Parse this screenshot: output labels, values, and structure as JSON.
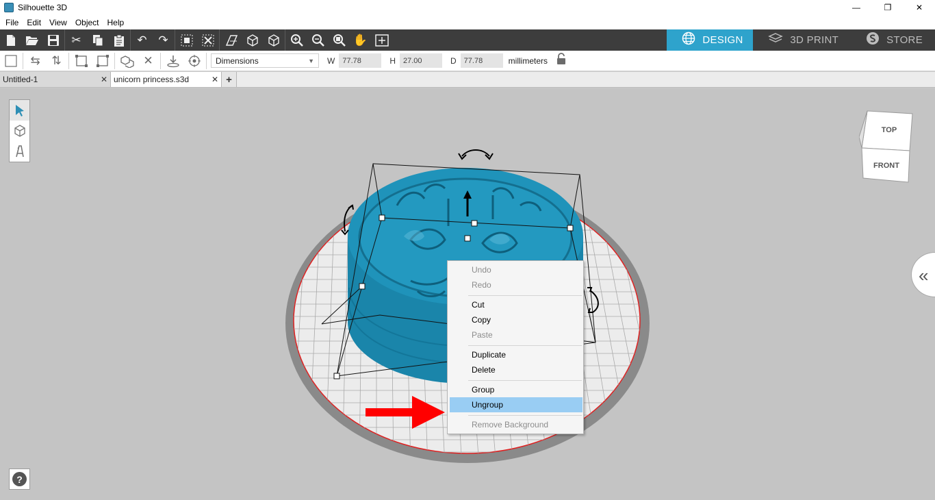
{
  "window": {
    "title": "Silhouette 3D",
    "minimize": "—",
    "maximize": "❐",
    "close": "✕"
  },
  "menu": [
    "File",
    "Edit",
    "View",
    "Object",
    "Help"
  ],
  "toolbar": {
    "modes": [
      {
        "label": "DESIGN",
        "icon": "globe-icon",
        "active": true
      },
      {
        "label": "3D PRINT",
        "icon": "print-layers-icon",
        "active": false
      },
      {
        "label": "STORE",
        "icon": "store-s-icon",
        "active": false
      }
    ]
  },
  "properties": {
    "mode_select": "Dimensions",
    "w_label": "W",
    "w_value": "77.78",
    "h_label": "H",
    "h_value": "27.00",
    "d_label": "D",
    "d_value": "77.78",
    "unit": "millimeters"
  },
  "tabs": [
    {
      "label": "Untitled-1",
      "close": "✕",
      "active": false
    },
    {
      "label": "unicorn princess.s3d",
      "close": "✕",
      "active": true
    }
  ],
  "add_tab": "+",
  "view_cube": {
    "top": "TOP",
    "front": "FRONT"
  },
  "help": "?",
  "context_menu": {
    "items": [
      {
        "label": "Undo",
        "enabled": false
      },
      {
        "label": "Redo",
        "enabled": false
      },
      {
        "label": "Cut",
        "enabled": true
      },
      {
        "label": "Copy",
        "enabled": true
      },
      {
        "label": "Paste",
        "enabled": false
      },
      {
        "label": "Duplicate",
        "enabled": true
      },
      {
        "label": "Delete",
        "enabled": true
      },
      {
        "label": "Group",
        "enabled": true
      },
      {
        "label": "Ungroup",
        "enabled": true,
        "highlighted": true
      },
      {
        "label": "Remove Background",
        "enabled": false
      }
    ]
  },
  "colors": {
    "accent": "#2ea3cc",
    "object": "#1f93ba",
    "menu_highlight": "#99cdf3",
    "annotation_arrow": "#ff0000"
  }
}
